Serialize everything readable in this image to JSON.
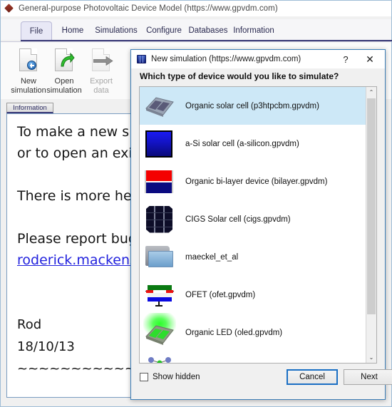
{
  "app": {
    "title": "General-purpose Photovoltaic Device Model (https://www.gpvdm.com)",
    "logo_icon": "gpvdm-diamond-icon",
    "tabs": [
      {
        "label": "File",
        "active": true
      },
      {
        "label": "Home",
        "active": false
      },
      {
        "label": "Simulations",
        "active": false
      },
      {
        "label": "Configure",
        "active": false
      },
      {
        "label": "Databases",
        "active": false
      },
      {
        "label": "Information",
        "active": false
      }
    ],
    "ribbon_buttons": [
      {
        "label_line1": "New",
        "label_line2": "simulation",
        "icon": "new-document-icon",
        "enabled": true
      },
      {
        "label_line1": "Open",
        "label_line2": "simulation",
        "icon": "open-document-icon",
        "enabled": true
      },
      {
        "label_line1": "Export",
        "label_line2": "data",
        "icon": "export-data-icon",
        "enabled": false
      }
    ],
    "info_tab_label": "Information",
    "info_text": {
      "line1": "To make a new s",
      "line2": "or to open an exi",
      "line3": "There is more he",
      "line4": "Please report bug",
      "link": "roderick.mackenz",
      "sig_name": "Rod",
      "sig_date": "18/10/13",
      "rule": "~~~~~~~~~~~~"
    }
  },
  "dialog": {
    "title": "New simulation (https://www.gpvdm.com)",
    "icon": "new-simulation-icon",
    "help_label": "?",
    "close_label": "✕",
    "question": "Which type of device would you like to simulate?",
    "items": [
      {
        "label": "Organic solar cell (p3htpcbm.gpvdm)",
        "icon": "organic-solar-cell-icon",
        "selected": true
      },
      {
        "label": "a-Si solar cell (a-silicon.gpvdm)",
        "icon": "a-si-solar-cell-icon",
        "selected": false
      },
      {
        "label": "Organic bi-layer device (bilayer.gpvdm)",
        "icon": "bilayer-device-icon",
        "selected": false
      },
      {
        "label": "CIGS Solar cell (cigs.gpvdm)",
        "icon": "cigs-solar-cell-icon",
        "selected": false
      },
      {
        "label": "maeckel_et_al",
        "icon": "folder-icon",
        "selected": false
      },
      {
        "label": "OFET (ofet.gpvdm)",
        "icon": "ofet-device-icon",
        "selected": false
      },
      {
        "label": "Organic LED (oled.gpvdm)",
        "icon": "organic-led-icon",
        "selected": false
      },
      {
        "label": "",
        "icon": "molecule-icon",
        "selected": false
      }
    ],
    "scrollbar": {
      "up_arrow": "⌃",
      "down_arrow": "⌄"
    },
    "show_hidden_label": "Show hidden",
    "show_hidden_checked": false,
    "cancel_label": "Cancel",
    "next_label": "Next"
  },
  "colors": {
    "selection": "#cde8f7",
    "focus_ring": "#1a6fc4",
    "ribbon_underline": "#3b3b78",
    "link": "#2222dd"
  }
}
